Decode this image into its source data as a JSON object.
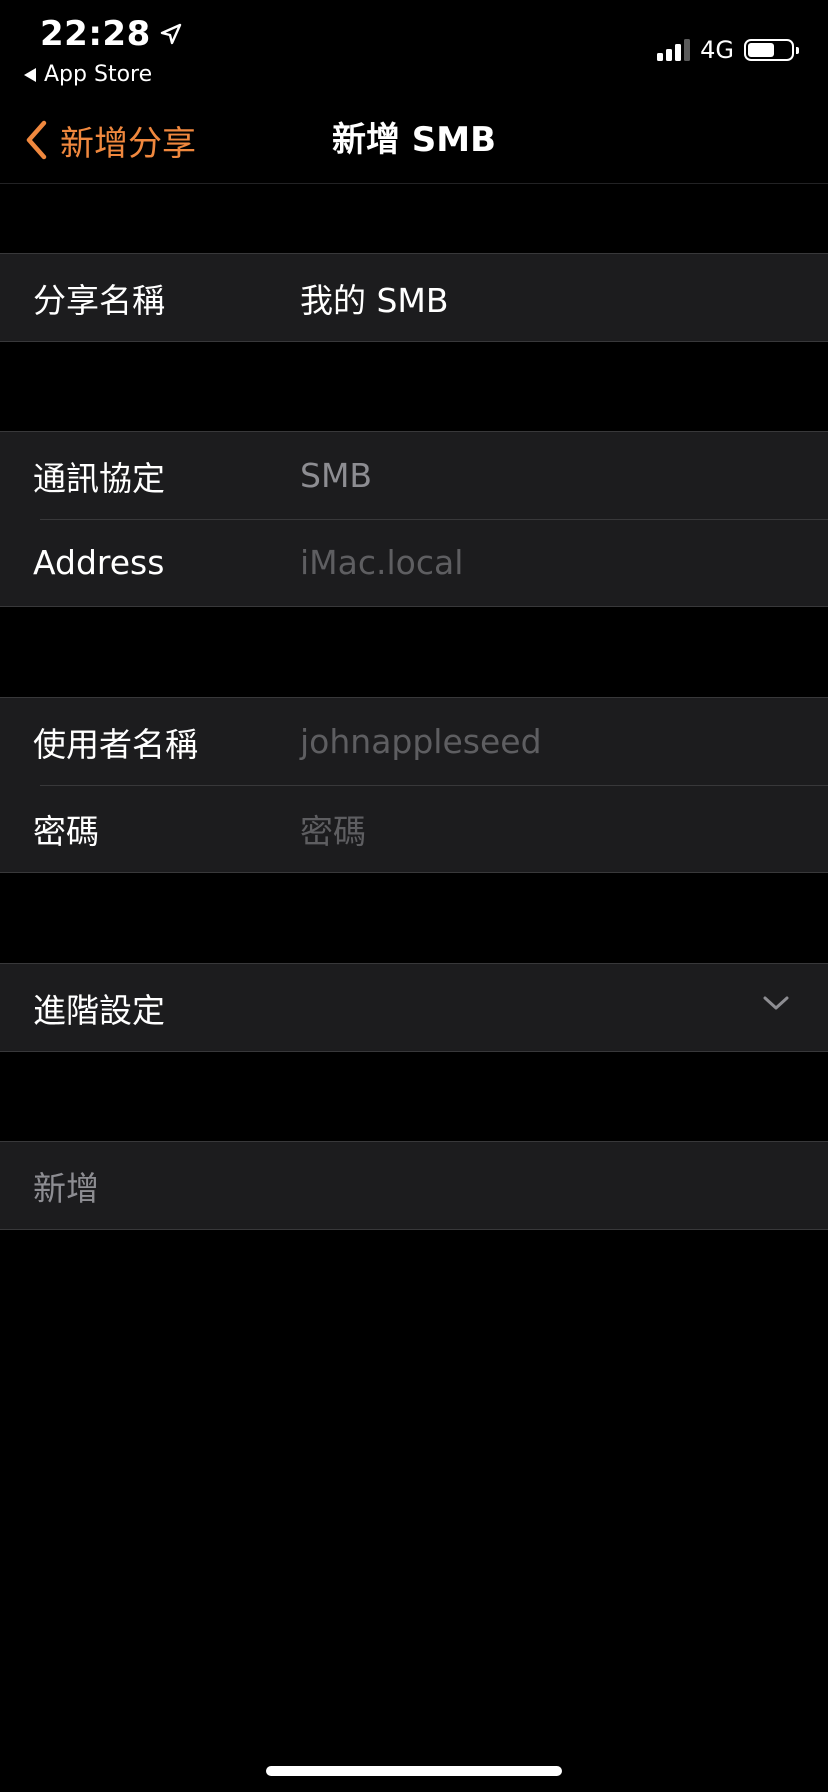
{
  "status_bar": {
    "time": "22:28",
    "back_app": "App Store",
    "network": "4G",
    "location_icon": "location-arrow-icon",
    "signal_icon": "cellular-signal-icon",
    "battery_icon": "battery-icon"
  },
  "nav": {
    "back_label": "新增分享",
    "title": "新增 SMB",
    "back_icon": "chevron-left-icon"
  },
  "form": {
    "share_name": {
      "label": "分享名稱",
      "value": "我的 SMB"
    },
    "protocol": {
      "label": "通訊協定",
      "value": "SMB"
    },
    "address": {
      "label": "Address",
      "placeholder": "iMac.local"
    },
    "username": {
      "label": "使用者名稱",
      "placeholder": "johnappleseed"
    },
    "password": {
      "label": "密碼",
      "placeholder": "密碼"
    },
    "advanced": {
      "label": "進階設定",
      "icon": "chevron-down-icon"
    },
    "add_button": {
      "label": "新增"
    }
  },
  "colors": {
    "accent": "#f0883e",
    "background": "#000000",
    "cell": "#1c1c1e",
    "separator": "#38383a",
    "placeholder": "#5e5e61",
    "secondary_text": "#8d8d92"
  }
}
